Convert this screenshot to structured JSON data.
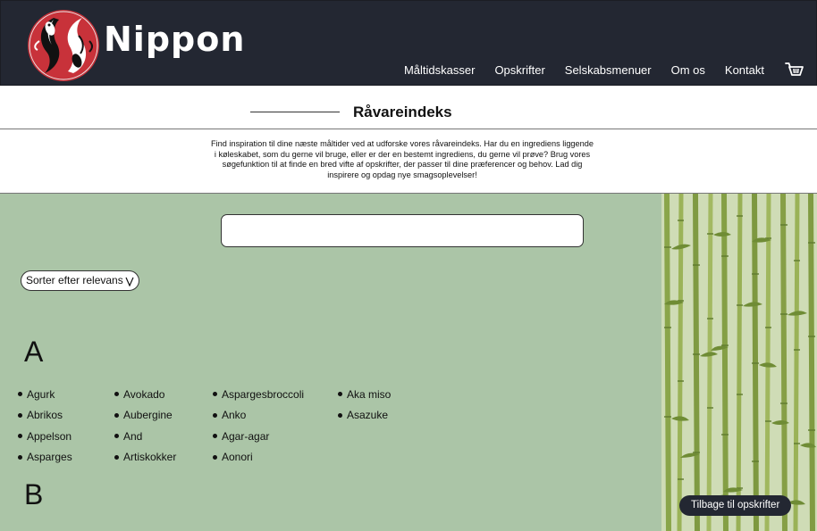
{
  "brand": {
    "name": "Nippon"
  },
  "nav": {
    "items": [
      {
        "label": "Måltidskasser"
      },
      {
        "label": "Opskrifter"
      },
      {
        "label": "Selskabsmenuer"
      },
      {
        "label": "Om os"
      },
      {
        "label": "Kontakt"
      }
    ],
    "cart_icon": "shopping-cart-icon"
  },
  "page": {
    "title": "Råvareindeks",
    "intro": "Find inspiration til dine næste måltider ved at udforske vores råvareindeks. Har du en ingrediens liggende i køleskabet, som du gerne vil bruge, eller er der en bestemt ingrediens, du gerne vil prøve? Brug vores søgefunktion til at finde en bred vifte af opskrifter, der passer til dine præferencer og behov. Lad dig inspirere og opdag nye smagsoplevelser!"
  },
  "search": {
    "value": "",
    "placeholder": ""
  },
  "sort": {
    "label": "Sorter efter relevans",
    "icon": "chevron-down-icon"
  },
  "index": {
    "letters": [
      "A",
      "B"
    ],
    "columns": [
      [
        "Agurk",
        "Abrikos",
        "Appelson",
        "Asparges"
      ],
      [
        "Avokado",
        "Aubergine",
        "And",
        "Artiskokker"
      ],
      [
        "Aspargesbroccoli",
        "Anko",
        "Agar-agar",
        "Aonori"
      ],
      [
        "Aka miso",
        "Asazuke"
      ]
    ]
  },
  "back_button": {
    "label": "Tilbage til opskrifter"
  },
  "colors": {
    "header_bg": "#232732",
    "content_bg": "#abc5a7",
    "logo_red": "#c8323a",
    "bamboo_green": "#8aa54a"
  }
}
